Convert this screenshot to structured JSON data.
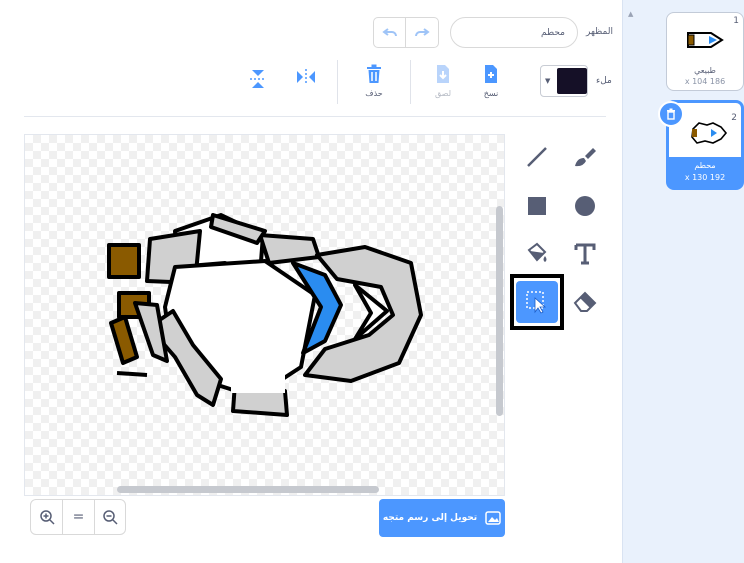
{
  "costume_header": {
    "costume_label": "المظهر",
    "costume_name_value": "محطم"
  },
  "fill": {
    "label": "ملء",
    "color": "#151027"
  },
  "toolbar": {
    "delete_label": "حذف",
    "paste_label": "لصق",
    "copy_label": "نسخ"
  },
  "costumes": [
    {
      "number": "1",
      "name": "طبيعي",
      "size": "x 104 186"
    },
    {
      "number": "2",
      "name": "محطم",
      "size": "x 130 192"
    }
  ],
  "zoom": {
    "out_label": "−",
    "reset_label": "=",
    "in_label": "+"
  },
  "convert_button": {
    "label": "تحويل إلى رسم متجه"
  },
  "colors": {
    "accent": "#4c97ff",
    "text": "#575e75",
    "pane": "#e9f1fc"
  },
  "icons": [
    "undo-icon",
    "redo-icon",
    "flip-vertical-icon",
    "flip-horizontal-icon",
    "trash-icon",
    "paste-icon",
    "copy-icon",
    "line-icon",
    "brush-icon",
    "rectangle-icon",
    "circle-icon",
    "fill-bucket-icon",
    "text-icon",
    "select-icon",
    "eraser-icon",
    "zoom-in-icon",
    "zoom-out-icon",
    "image-icon"
  ]
}
